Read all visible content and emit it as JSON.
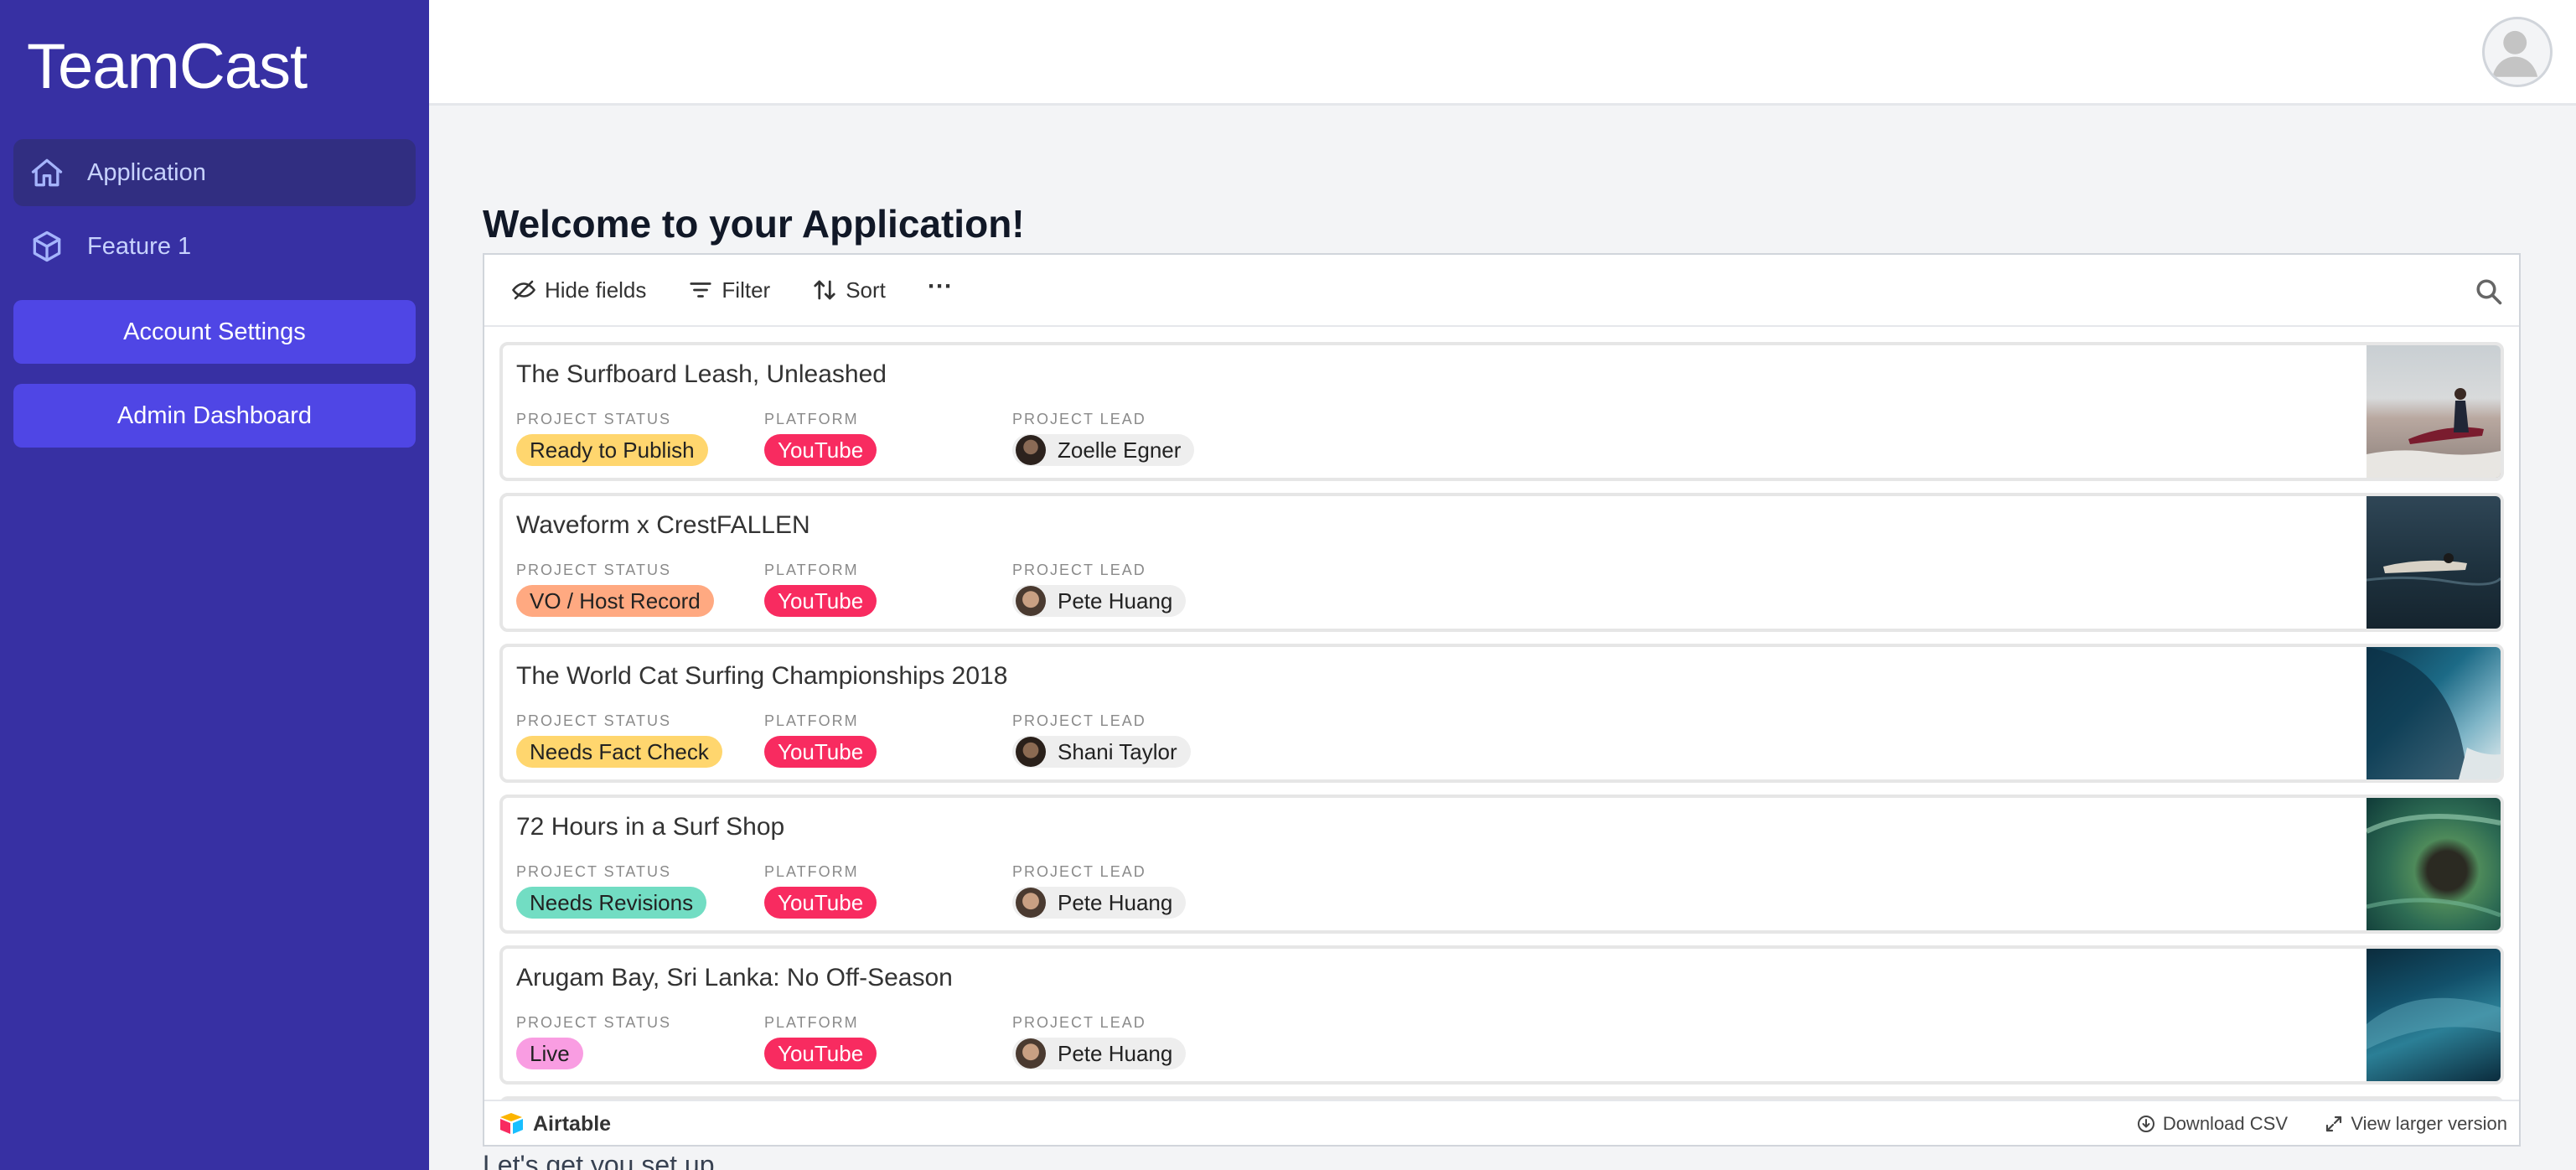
{
  "sidebar": {
    "brand": "TeamCast",
    "nav": [
      {
        "label": "Application",
        "icon": "home-icon"
      },
      {
        "label": "Feature 1",
        "icon": "cube-icon"
      }
    ],
    "buttons": [
      "Account Settings",
      "Admin Dashboard"
    ],
    "colors": {
      "background": "#3730a3",
      "active": "#312e81",
      "button": "#4f46e5"
    }
  },
  "header": {
    "avatar_icon": "user-avatar-icon"
  },
  "main": {
    "welcome": "Welcome to your Application!",
    "below_text": "Let's get you set up"
  },
  "embed": {
    "toolbar": {
      "hide_fields": "Hide fields",
      "filter": "Filter",
      "sort": "Sort",
      "more": "···"
    },
    "labels": {
      "status": "PROJECT STATUS",
      "platform": "PLATFORM",
      "lead": "PROJECT LEAD"
    },
    "records": [
      {
        "title": "The Surfboard Leash, Unleashed",
        "status": "Ready to Publish",
        "status_color": "#ffd66e",
        "platform": "YouTube",
        "lead": "Zoelle Egner"
      },
      {
        "title": "Waveform x CrestFALLEN",
        "status": "VO / Host Record",
        "status_color": "#ffa981",
        "platform": "YouTube",
        "lead": "Pete Huang"
      },
      {
        "title": "The World Cat Surfing Championships 2018",
        "status": "Needs Fact Check",
        "status_color": "#ffd66e",
        "platform": "YouTube",
        "lead": "Shani Taylor"
      },
      {
        "title": "72 Hours in a Surf Shop",
        "status": "Needs Revisions",
        "status_color": "#72ddc3",
        "platform": "YouTube",
        "lead": "Pete Huang"
      },
      {
        "title": "Arugam Bay, Sri Lanka: No Off-Season",
        "status": "Live",
        "status_color": "#f99de2",
        "platform": "YouTube",
        "lead": "Pete Huang"
      }
    ],
    "platform_color": "#f82b60",
    "footer": {
      "brand": "Airtable",
      "download": "Download CSV",
      "larger": "View larger version"
    }
  }
}
